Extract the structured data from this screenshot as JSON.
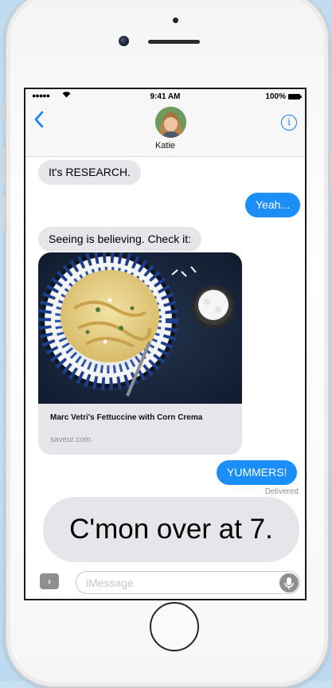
{
  "status_bar": {
    "signal": "●●●●●",
    "time": "9:41 AM",
    "battery": "100%"
  },
  "nav": {
    "contact_name": "Katie",
    "back_icon": "chevron-left-icon",
    "info_icon": "info-icon",
    "info_glyph": "i"
  },
  "messages": [
    {
      "direction": "incoming",
      "text": "It's RESEARCH."
    },
    {
      "direction": "outgoing",
      "text": "Yeah..."
    },
    {
      "direction": "incoming",
      "text": "Seeing is believing. Check it:"
    },
    {
      "direction": "outgoing",
      "text": "YUMMERS!"
    },
    {
      "direction": "incoming",
      "text": "C'mon over at 7."
    }
  ],
  "link_preview": {
    "title": "Marc Vetri's Fettuccine with Corn Crema",
    "domain": "saveur.com"
  },
  "delivered_label": "Delivered",
  "input": {
    "placeholder": "iMessage",
    "value": "",
    "apps_glyph": "›"
  },
  "colors": {
    "outgoing_bubble": "#1b8ef7",
    "incoming_bubble": "#e5e5ea",
    "accent": "#147efb"
  }
}
